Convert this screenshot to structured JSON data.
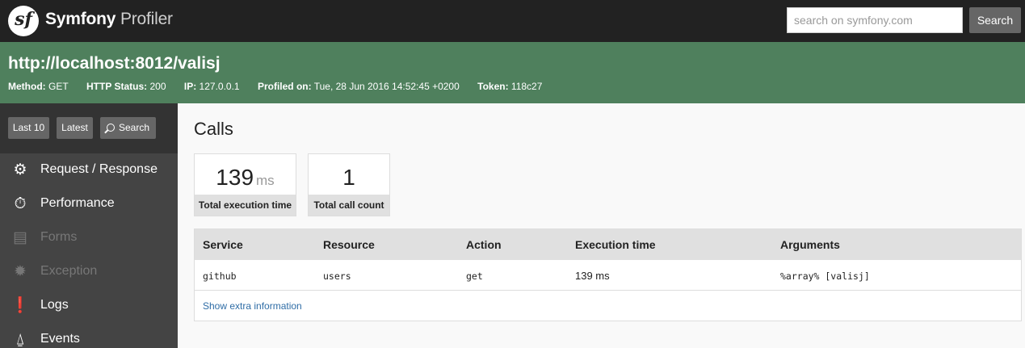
{
  "header": {
    "logo_glyph": "sf",
    "brand_primary": "Symfony",
    "brand_secondary": "Profiler",
    "search_placeholder": "search on symfony.com",
    "search_button": "Search"
  },
  "summary": {
    "url": "http://localhost:8012/valisj",
    "meta": [
      {
        "key": "Method:",
        "value": "GET"
      },
      {
        "key": "HTTP Status:",
        "value": "200"
      },
      {
        "key": "IP:",
        "value": "127.0.0.1"
      },
      {
        "key": "Profiled on:",
        "value": "Tue, 28 Jun 2016 14:52:45 +0200"
      },
      {
        "key": "Token:",
        "value": "118c27"
      }
    ]
  },
  "sidebar": {
    "buttons": {
      "last10": "Last 10",
      "latest": "Latest",
      "search": "Search"
    },
    "items": [
      {
        "label": "Request / Response",
        "icon": "gears-icon",
        "glyph": "⚙",
        "disabled": false
      },
      {
        "label": "Performance",
        "icon": "stopwatch-icon",
        "glyph": "⏱",
        "disabled": false
      },
      {
        "label": "Forms",
        "icon": "clipboard-icon",
        "glyph": "▤",
        "disabled": true
      },
      {
        "label": "Exception",
        "icon": "bug-icon",
        "glyph": "✹",
        "disabled": true
      },
      {
        "label": "Logs",
        "icon": "alert-document-icon",
        "glyph": "❗",
        "disabled": false
      },
      {
        "label": "Events",
        "icon": "broadcast-icon",
        "glyph": "⍙",
        "disabled": false
      }
    ]
  },
  "main": {
    "title": "Calls",
    "metrics": [
      {
        "value": "139",
        "unit": "ms",
        "label": "Total execution time"
      },
      {
        "value": "1",
        "unit": "",
        "label": "Total call count"
      }
    ],
    "table": {
      "headers": [
        "Service",
        "Resource",
        "Action",
        "Execution time",
        "Arguments"
      ],
      "rows": [
        [
          "github",
          "users",
          "get",
          "139 ms",
          "%array% [valisj]"
        ]
      ]
    },
    "extra_link": "Show extra information"
  },
  "colors": {
    "topbar": "#222222",
    "summary_green": "#4f805d",
    "sidebar": "#444444",
    "link": "#2f6da6"
  }
}
